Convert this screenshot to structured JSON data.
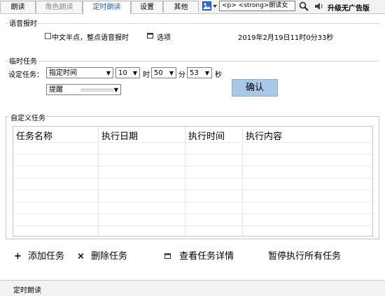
{
  "tabs": [
    {
      "label": "朗读",
      "state": "normal"
    },
    {
      "label": "角色朗读",
      "state": "dim"
    },
    {
      "label": "定时朗读",
      "state": "active"
    },
    {
      "label": "设置",
      "state": "normal"
    },
    {
      "label": "其他",
      "state": "normal"
    }
  ],
  "toolbar": {
    "combo_text": "<p>    <strong>朗读女",
    "upgrade_label": "升级无广告版",
    "icons": [
      "image-icon",
      "dropdown-arrow-icon",
      "search-icon",
      "speaker-icon"
    ]
  },
  "voice_report": {
    "title": "语音报时",
    "checkbox_label": "中文半点，整点语音报时",
    "checkbox_checked": false,
    "options_label": "选项",
    "datetime": "2019年2月19日11时0分33秒"
  },
  "temp_task": {
    "title": "临时任务",
    "setting_label": "设定任务：",
    "mode_value": "指定时间",
    "hour_value": "10",
    "hour_unit": "时",
    "minute_value": "50",
    "minute_unit": "分",
    "second_value": "53",
    "second_unit": "秒",
    "action_value": "提醒",
    "confirm_label": "确认"
  },
  "custom_task": {
    "title": "自定义任务",
    "columns": [
      "任务名称",
      "执行日期",
      "执行时间",
      "执行内容"
    ],
    "rows": []
  },
  "actions": {
    "add_label": "添加任务",
    "delete_label": "删除任务",
    "detail_label": "查看任务详情",
    "pause_label": "暂停执行所有任务"
  },
  "statusbar": {
    "text": "定时朗读"
  },
  "colors": {
    "accent": "#1f5fc6",
    "confirm_bg": "#a8c8e8"
  }
}
